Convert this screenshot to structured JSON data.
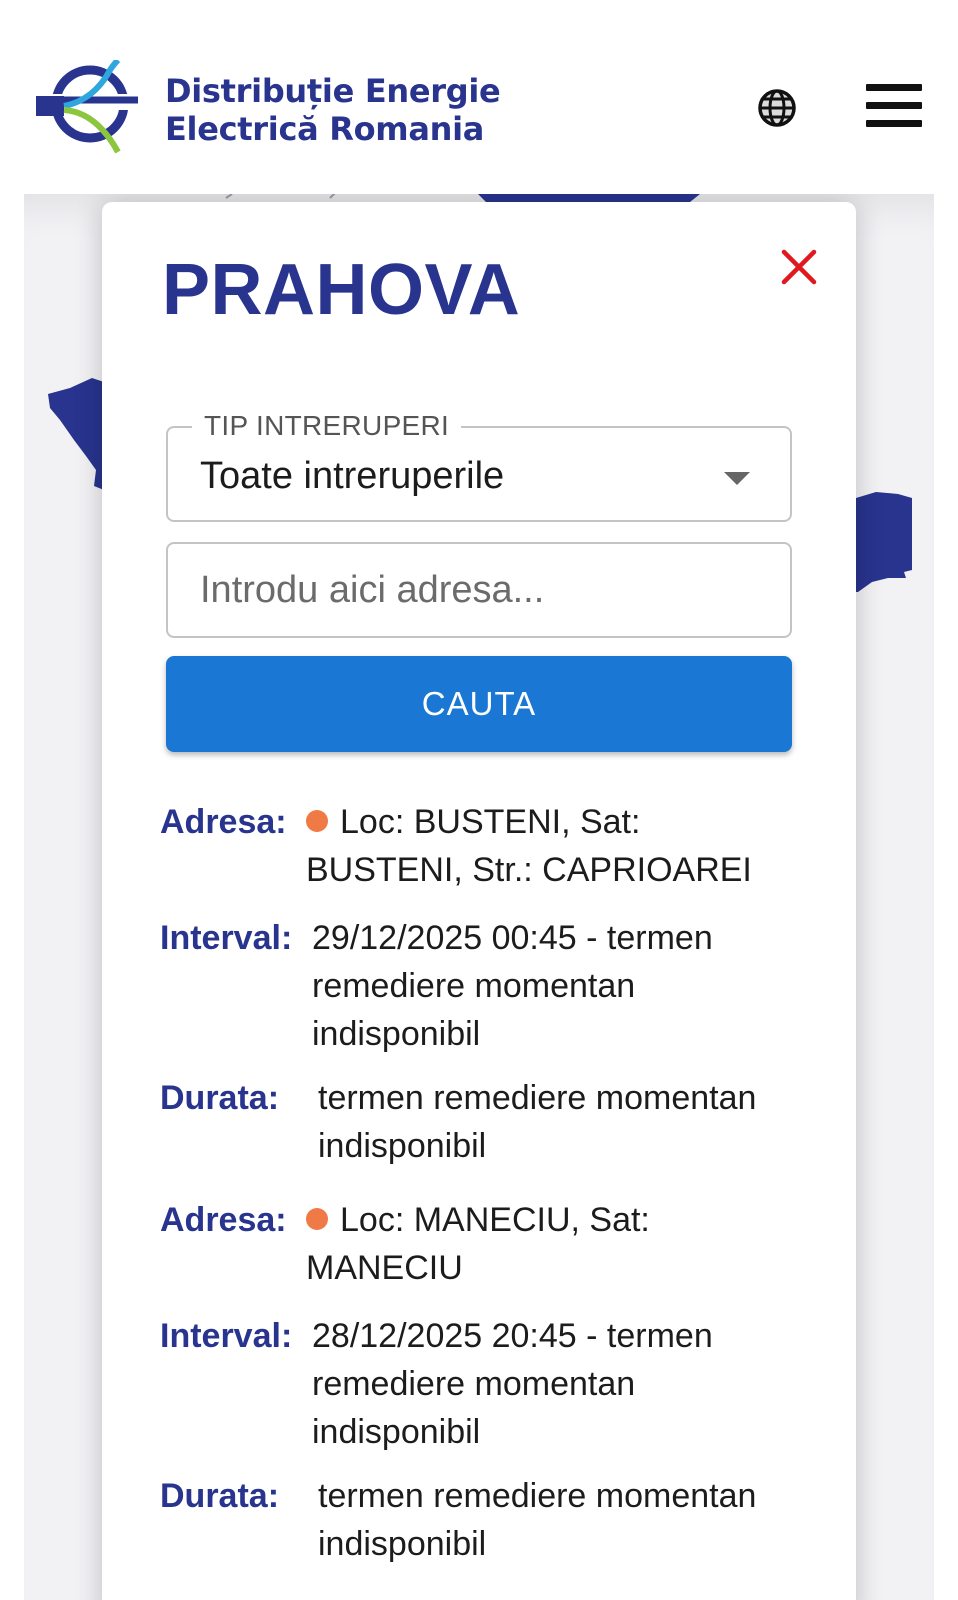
{
  "header": {
    "brand_line1": "Distribuție Energie",
    "brand_line2": "Electrică Romania",
    "language_icon": "globe-icon",
    "menu_icon": "hamburger-menu-icon"
  },
  "colors": {
    "brand_blue": "#28348e",
    "button_blue": "#1b77d4",
    "close_red": "#e0191f",
    "status_dot": "#f07a45"
  },
  "panel": {
    "county": "PRAHOVA",
    "close_icon": "close-icon",
    "filter": {
      "legend": "TIP INTRERUPERI",
      "selected": "Toate intreruperile"
    },
    "search": {
      "placeholder": "Introdu aici adresa...",
      "button_label": "CAUTA"
    },
    "results": [
      {
        "address_label": "Adresa:",
        "address": "Loc: BUSTENI, Sat: BUSTENI, Str.: CAPRIOAREI",
        "interval_label": "Interval:",
        "interval": "29/12/2025 00:45 - termen remediere momentan indisponibil",
        "duration_label": "Durata:",
        "duration": "termen remediere momentan indisponibil"
      },
      {
        "address_label": "Adresa:",
        "address": "Loc: MANECIU, Sat: MANECIU",
        "interval_label": "Interval:",
        "interval": "28/12/2025 20:45 - termen remediere momentan indisponibil",
        "duration_label": "Durata:",
        "duration": "termen remediere momentan indisponibil"
      }
    ]
  }
}
